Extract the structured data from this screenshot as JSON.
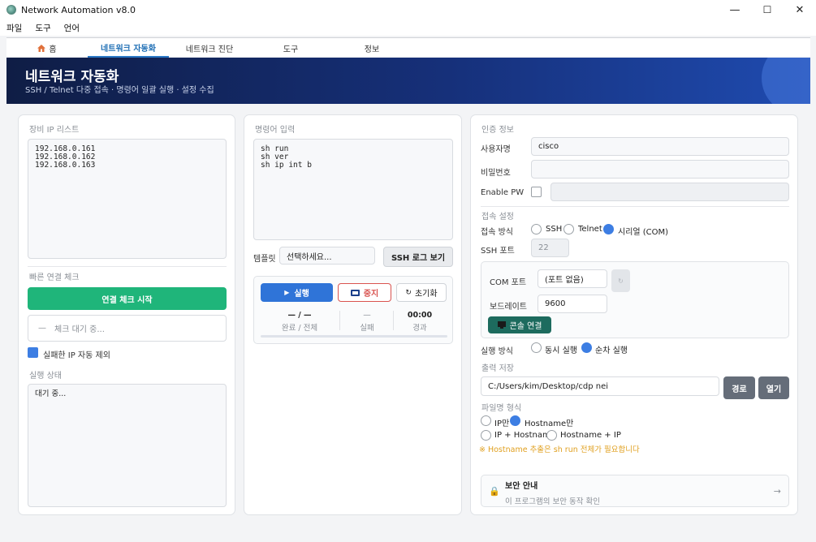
{
  "window": {
    "title": "Network Automation v8.0",
    "minimize": "—",
    "maximize": "☐",
    "close": "✕"
  },
  "menu": [
    "파일",
    "도구",
    "언어"
  ],
  "tabs": [
    "홈",
    "네트워크 자동화",
    "네트워크 진단",
    "도구",
    "정보"
  ],
  "banner": {
    "title": "네트워크 자동화",
    "subtitle": "SSH / Telnet 다중 접속 · 명령어 일괄 실행 · 설정 수집"
  },
  "left": {
    "ip_list_label": "장비 IP 리스트",
    "ip_list": "192.168.0.161\n192.168.0.162\n192.168.0.163",
    "quick_check_label": "빠른 연결 체크",
    "start_check_button": "연결 체크 시작",
    "check_status_dash": "—",
    "check_status": "체크 대기 중...",
    "exclude_failed_label": "실패한 IP 자동 제외",
    "run_status_label": "실행 상태",
    "run_status": "대기 중..."
  },
  "middle": {
    "command_label": "명령어 입력",
    "commands": "sh run\nsh ver\nsh ip int b",
    "template_label": "템플릿",
    "template_value": "선택하세요...",
    "ssh_log_button": "SSH 로그 보기",
    "run_button": "실행",
    "stop_button": "중지",
    "reset_button": "초기화",
    "stats": {
      "progress_value": "— / —",
      "progress_label": "완료 / 전체",
      "fail_value": "—",
      "fail_label": "실패",
      "elapsed_value": "00:00",
      "elapsed_label": "경과"
    }
  },
  "right": {
    "auth_label": "인증 정보",
    "username_label": "사용자명",
    "username_value": "cisco",
    "password_label": "비밀번호",
    "enable_label": "Enable PW",
    "connection_label": "접속 설정",
    "method_label": "접속 방식",
    "method_options": [
      "SSH",
      "Telnet",
      "시리얼 (COM)"
    ],
    "ssh_port_label": "SSH 포트",
    "ssh_port_value": "22",
    "com_port_label": "COM 포트",
    "com_port_value": "(포트 없음)",
    "baud_label": "보드레이트",
    "baud_value": "9600",
    "console_button": "콘솔 연결",
    "exec_mode_label": "실행 방식",
    "exec_modes": [
      "동시 실행",
      "순차 실행"
    ],
    "output_label": "출력 저장",
    "output_path": "C:/Users/kim/Desktop/cdp nei",
    "browse_button": "경로",
    "open_button": "열기",
    "filename_label": "파일명 형식",
    "filename_options": [
      "IP만",
      "Hostname만",
      "IP + Hostname",
      "Hostname + IP"
    ],
    "filename_note": "※ Hostname 추출은 sh run 전체가 필요합니다",
    "security_title": "보안 안내",
    "security_desc": "이 프로그램의 보안 동작 확인",
    "security_arrow": "→"
  },
  "colors": {
    "accent": "#2a78c5",
    "green": "#1fb57a",
    "blue": "#2f74d8",
    "red": "#d9534f",
    "teal": "#1d6b5e",
    "warning": "#e0a020"
  }
}
